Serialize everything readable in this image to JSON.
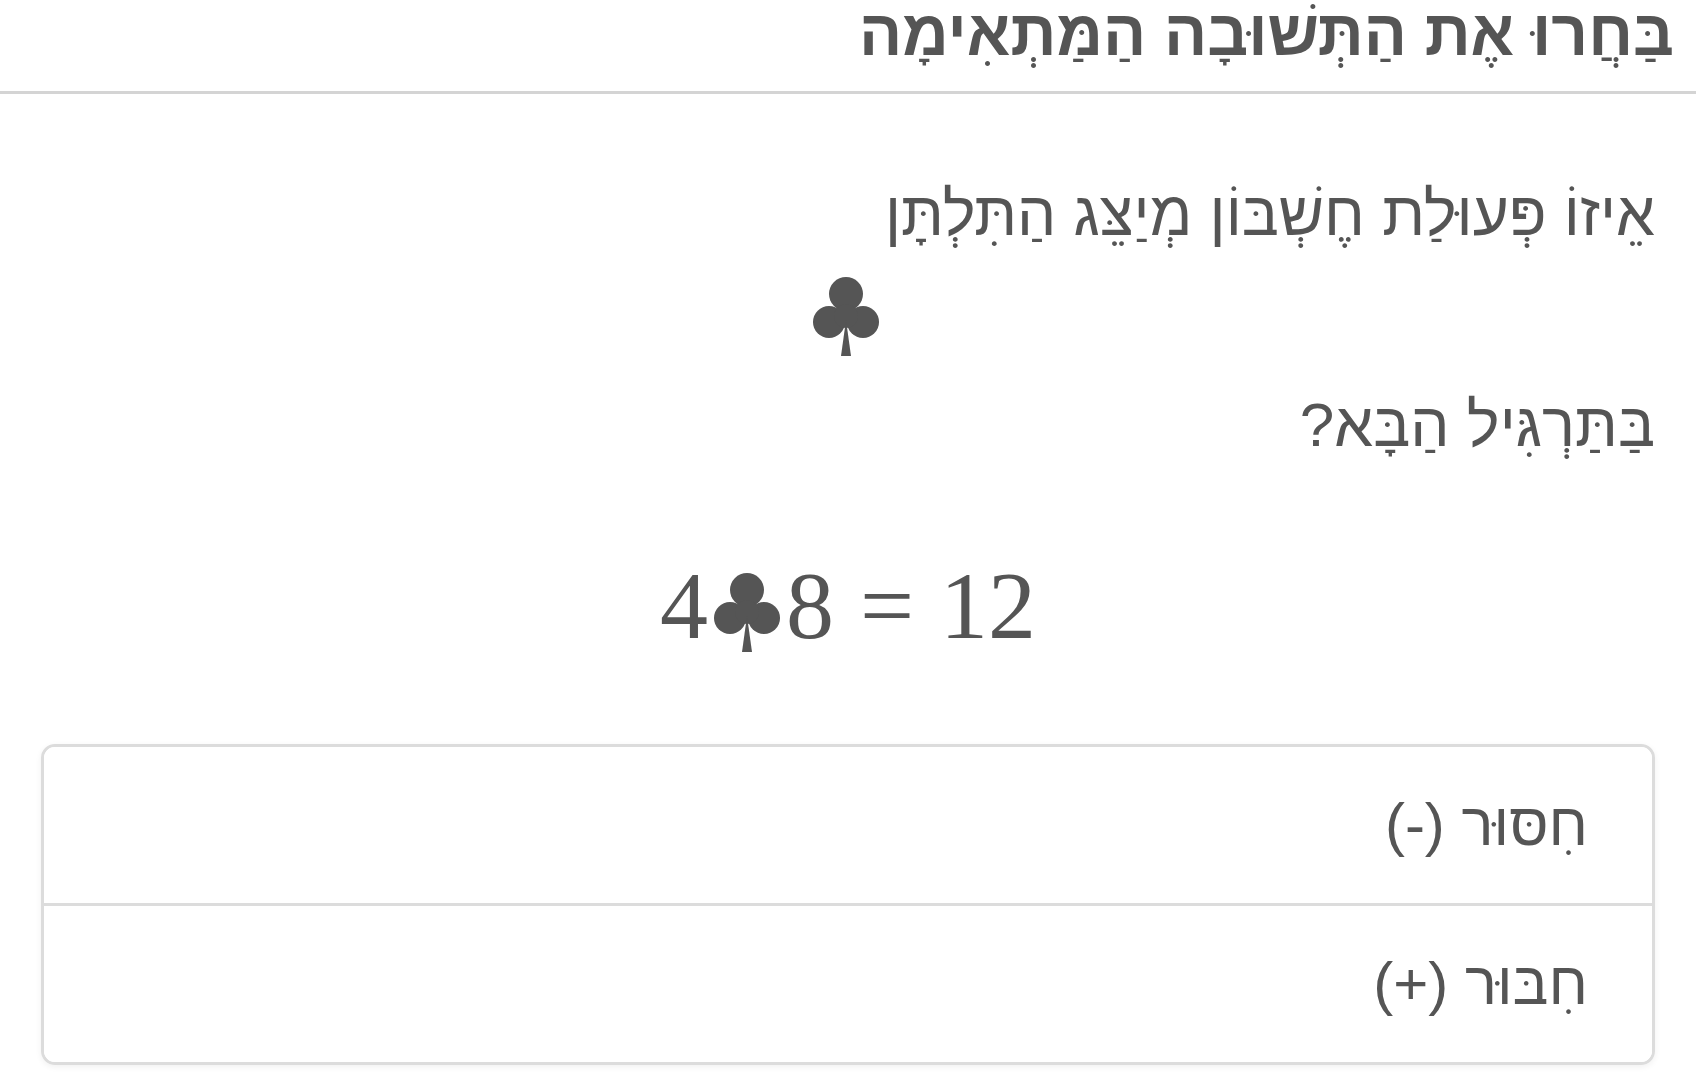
{
  "header": {
    "title": "בַּחֲרוּ אֶת הַתְּשׁוּבָה הַמַּתְאִימָה"
  },
  "question": {
    "prompt": [
      "אֵיזוֹ פְּעוּלַת חֶשְׁבּוֹן מְיַצֵּג הַתִּלְתָּן",
      "בַּתַּרְגִּיל הַבָּא?"
    ],
    "equation": {
      "left_operand": "4",
      "right_operand": "8",
      "equals_sign": "=",
      "result": "12"
    }
  },
  "options": [
    {
      "label": "חִסּוּר (-)",
      "selected": false
    },
    {
      "label": "חִבּוּר (+)",
      "selected": false
    }
  ]
}
